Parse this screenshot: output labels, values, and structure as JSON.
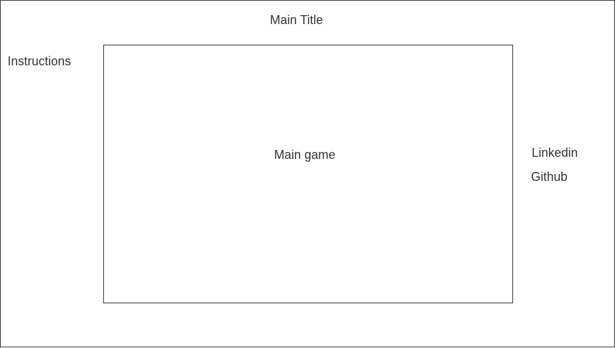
{
  "page": {
    "main_title": "Main Title",
    "instructions": "Instructions",
    "main_game": "Main game",
    "links": {
      "linkedin": "Linkedin",
      "github": "Github"
    }
  }
}
